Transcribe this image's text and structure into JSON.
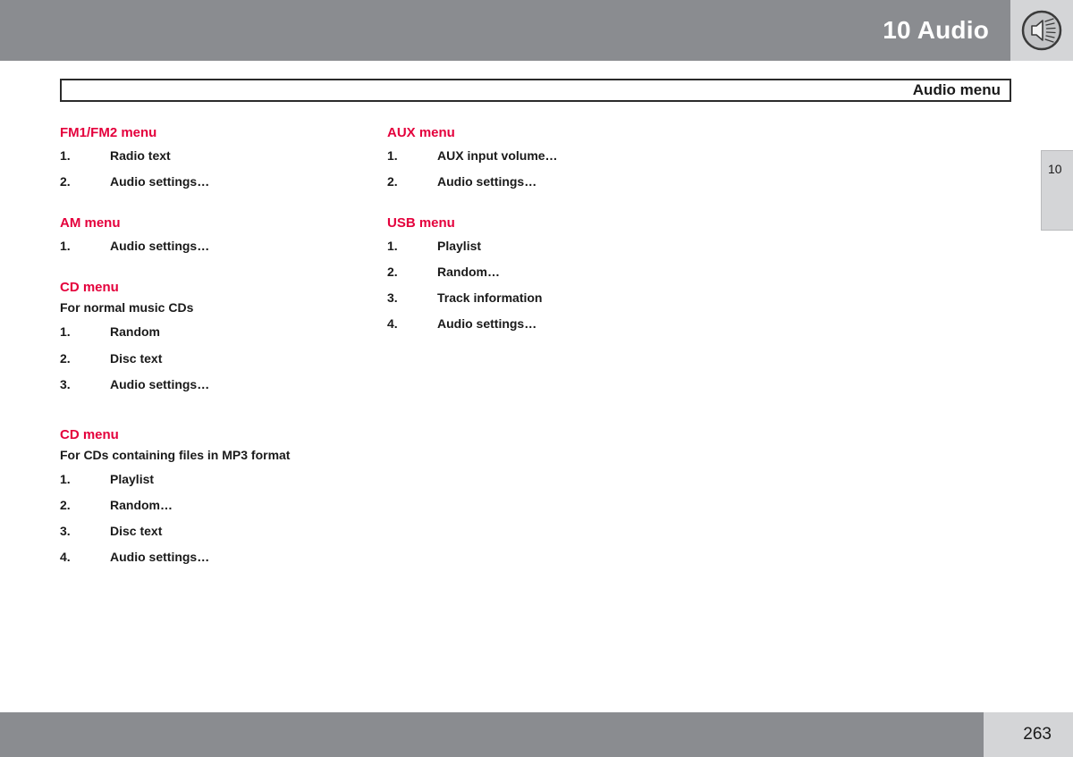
{
  "header": {
    "chapter_title": "10 Audio",
    "icon": "speaker-sound-icon",
    "bar_color": "#8a8c90",
    "icon_panel_color": "#d4d5d7"
  },
  "title_box": {
    "label": "Audio menu"
  },
  "side_tab": {
    "chapter_number": "10"
  },
  "accent_color": "#e4003c",
  "columns": {
    "left": [
      {
        "heading": "FM1/FM2 menu",
        "subtitle": "",
        "items": [
          {
            "number": "1.",
            "label": "Radio text"
          },
          {
            "number": "2.",
            "label": "Audio settings…"
          }
        ]
      },
      {
        "heading": "AM menu",
        "subtitle": "",
        "items": [
          {
            "number": "1.",
            "label": "Audio settings…"
          }
        ]
      },
      {
        "heading": "CD menu",
        "subtitle": "For normal music CDs",
        "items": [
          {
            "number": "1.",
            "label": "Random"
          },
          {
            "number": "2.",
            "label": "Disc text"
          },
          {
            "number": "3.",
            "label": "Audio settings…"
          }
        ]
      },
      {
        "heading": "CD menu",
        "subtitle": "For CDs containing files in MP3 format",
        "items": [
          {
            "number": "1.",
            "label": "Playlist"
          },
          {
            "number": "2.",
            "label": "Random…"
          },
          {
            "number": "3.",
            "label": "Disc text"
          },
          {
            "number": "4.",
            "label": "Audio settings…"
          }
        ]
      }
    ],
    "right": [
      {
        "heading": "AUX menu",
        "subtitle": "",
        "items": [
          {
            "number": "1.",
            "label": "AUX input volume…"
          },
          {
            "number": "2.",
            "label": "Audio settings…"
          }
        ]
      },
      {
        "heading": "USB menu",
        "subtitle": "",
        "items": [
          {
            "number": "1.",
            "label": "Playlist"
          },
          {
            "number": "2.",
            "label": "Random…"
          },
          {
            "number": "3.",
            "label": "Track information"
          },
          {
            "number": "4.",
            "label": "Audio settings…"
          }
        ]
      }
    ]
  },
  "footer": {
    "page_number": "263"
  }
}
